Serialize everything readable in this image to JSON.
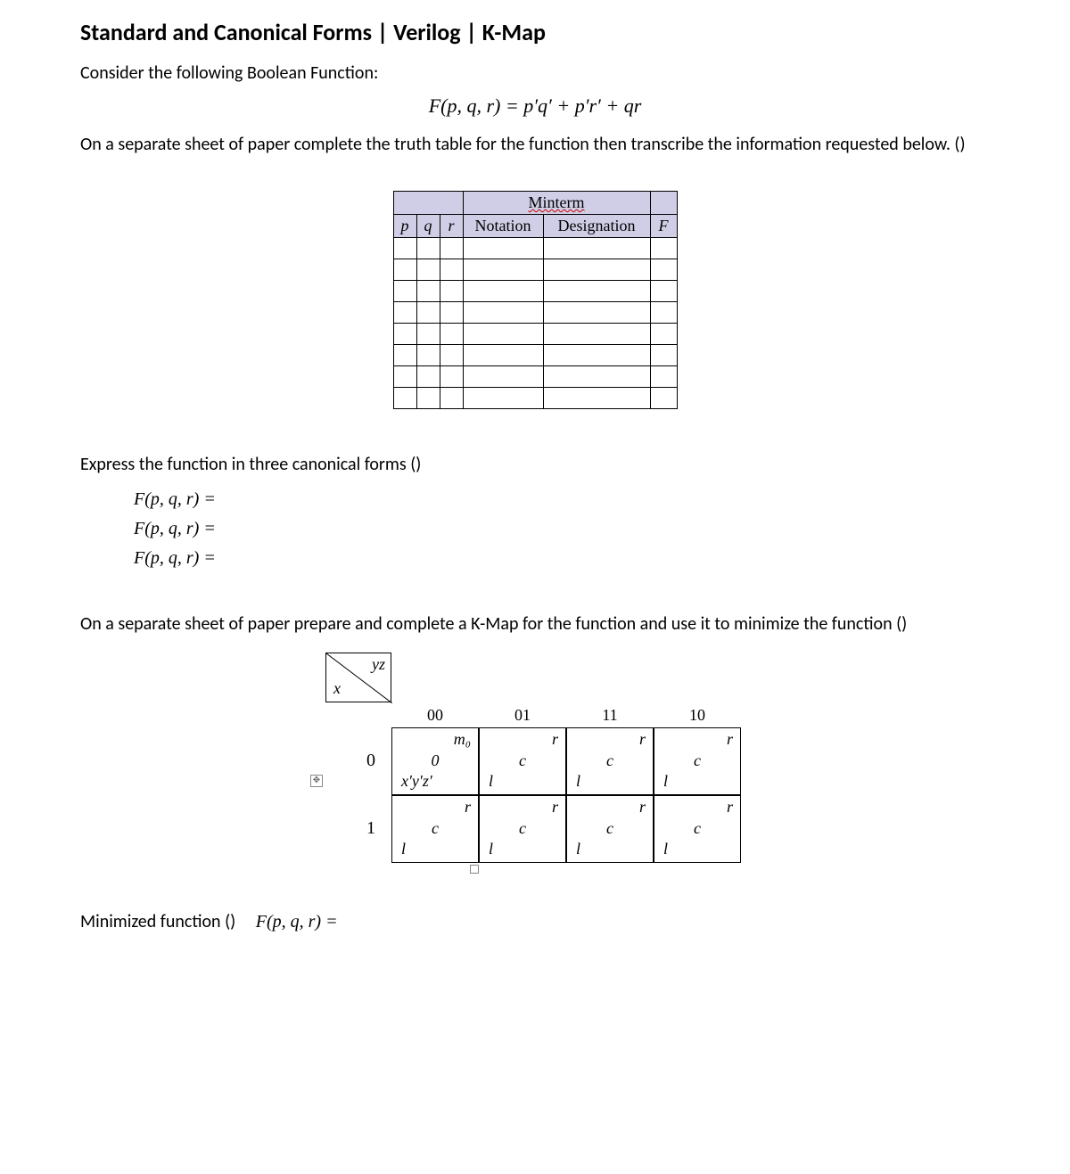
{
  "title": "Standard and Canonical Forms | Verilog | K-Map",
  "intro1": "Consider the following Boolean Function:",
  "equation": "F(p, q, r) = p′q′ + p′r′ + qr",
  "intro2": "On a separate sheet of paper complete the truth table for the function then transcribe the information requested below. ()",
  "truth_table": {
    "minterm_header": "Minterm",
    "cols": {
      "p": "p",
      "q": "q",
      "r": "r",
      "notation": "Notation",
      "designation": "Designation",
      "F": "F"
    }
  },
  "canon_intro": "Express the function in three canonical forms ()",
  "canon_line": "F(p, q, r) =",
  "kmap_intro": "On a separate sheet of paper prepare and complete a K-Map for the function and use it to minimize the function ()",
  "kmap": {
    "corner": {
      "yz": "yz",
      "x": "x"
    },
    "col_headers": [
      "00",
      "01",
      "11",
      "10"
    ],
    "row_headers": [
      "0",
      "1"
    ],
    "cells": [
      [
        {
          "tr": "m₀",
          "mid": "0",
          "bl": "x′y′z′"
        },
        {
          "tr": "r",
          "mid": "c",
          "bl": "l"
        },
        {
          "tr": "r",
          "mid": "c",
          "bl": "l"
        },
        {
          "tr": "r",
          "mid": "c",
          "bl": "l"
        }
      ],
      [
        {
          "tr": "r",
          "mid": "c",
          "bl": "l"
        },
        {
          "tr": "r",
          "mid": "c",
          "bl": "l"
        },
        {
          "tr": "r",
          "mid": "c",
          "bl": "l"
        },
        {
          "tr": "r",
          "mid": "c",
          "bl": "l"
        }
      ]
    ]
  },
  "minimized_label": "Minimized function ()",
  "minimized_func": "F(p, q, r) ="
}
